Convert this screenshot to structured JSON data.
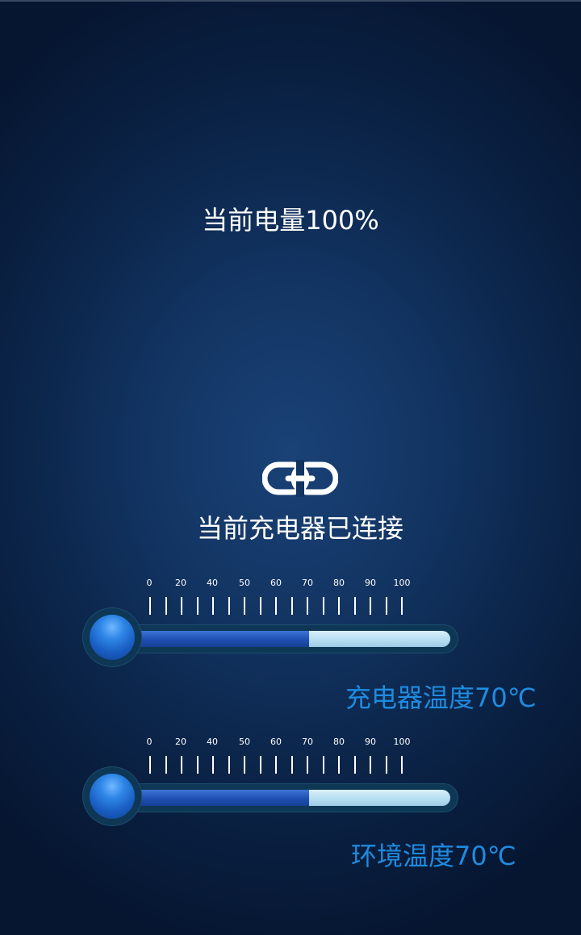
{
  "status": {
    "battery_text": "当前电量100%",
    "charger_connected_text": "当前充电器已连接",
    "link_icon": "link-icon"
  },
  "colors": {
    "text_primary": "#ffffff",
    "temp_label": "#1f8be0",
    "background_center": "#1a4277",
    "background_edge": "#061631"
  },
  "scale_labels": [
    "0",
    "20",
    "40",
    "50",
    "60",
    "70",
    "80",
    "90",
    "100"
  ],
  "thermometers": [
    {
      "label": "充电器温度70℃",
      "level_percent": 55
    },
    {
      "label": "环境温度70℃",
      "level_percent": 55
    }
  ]
}
